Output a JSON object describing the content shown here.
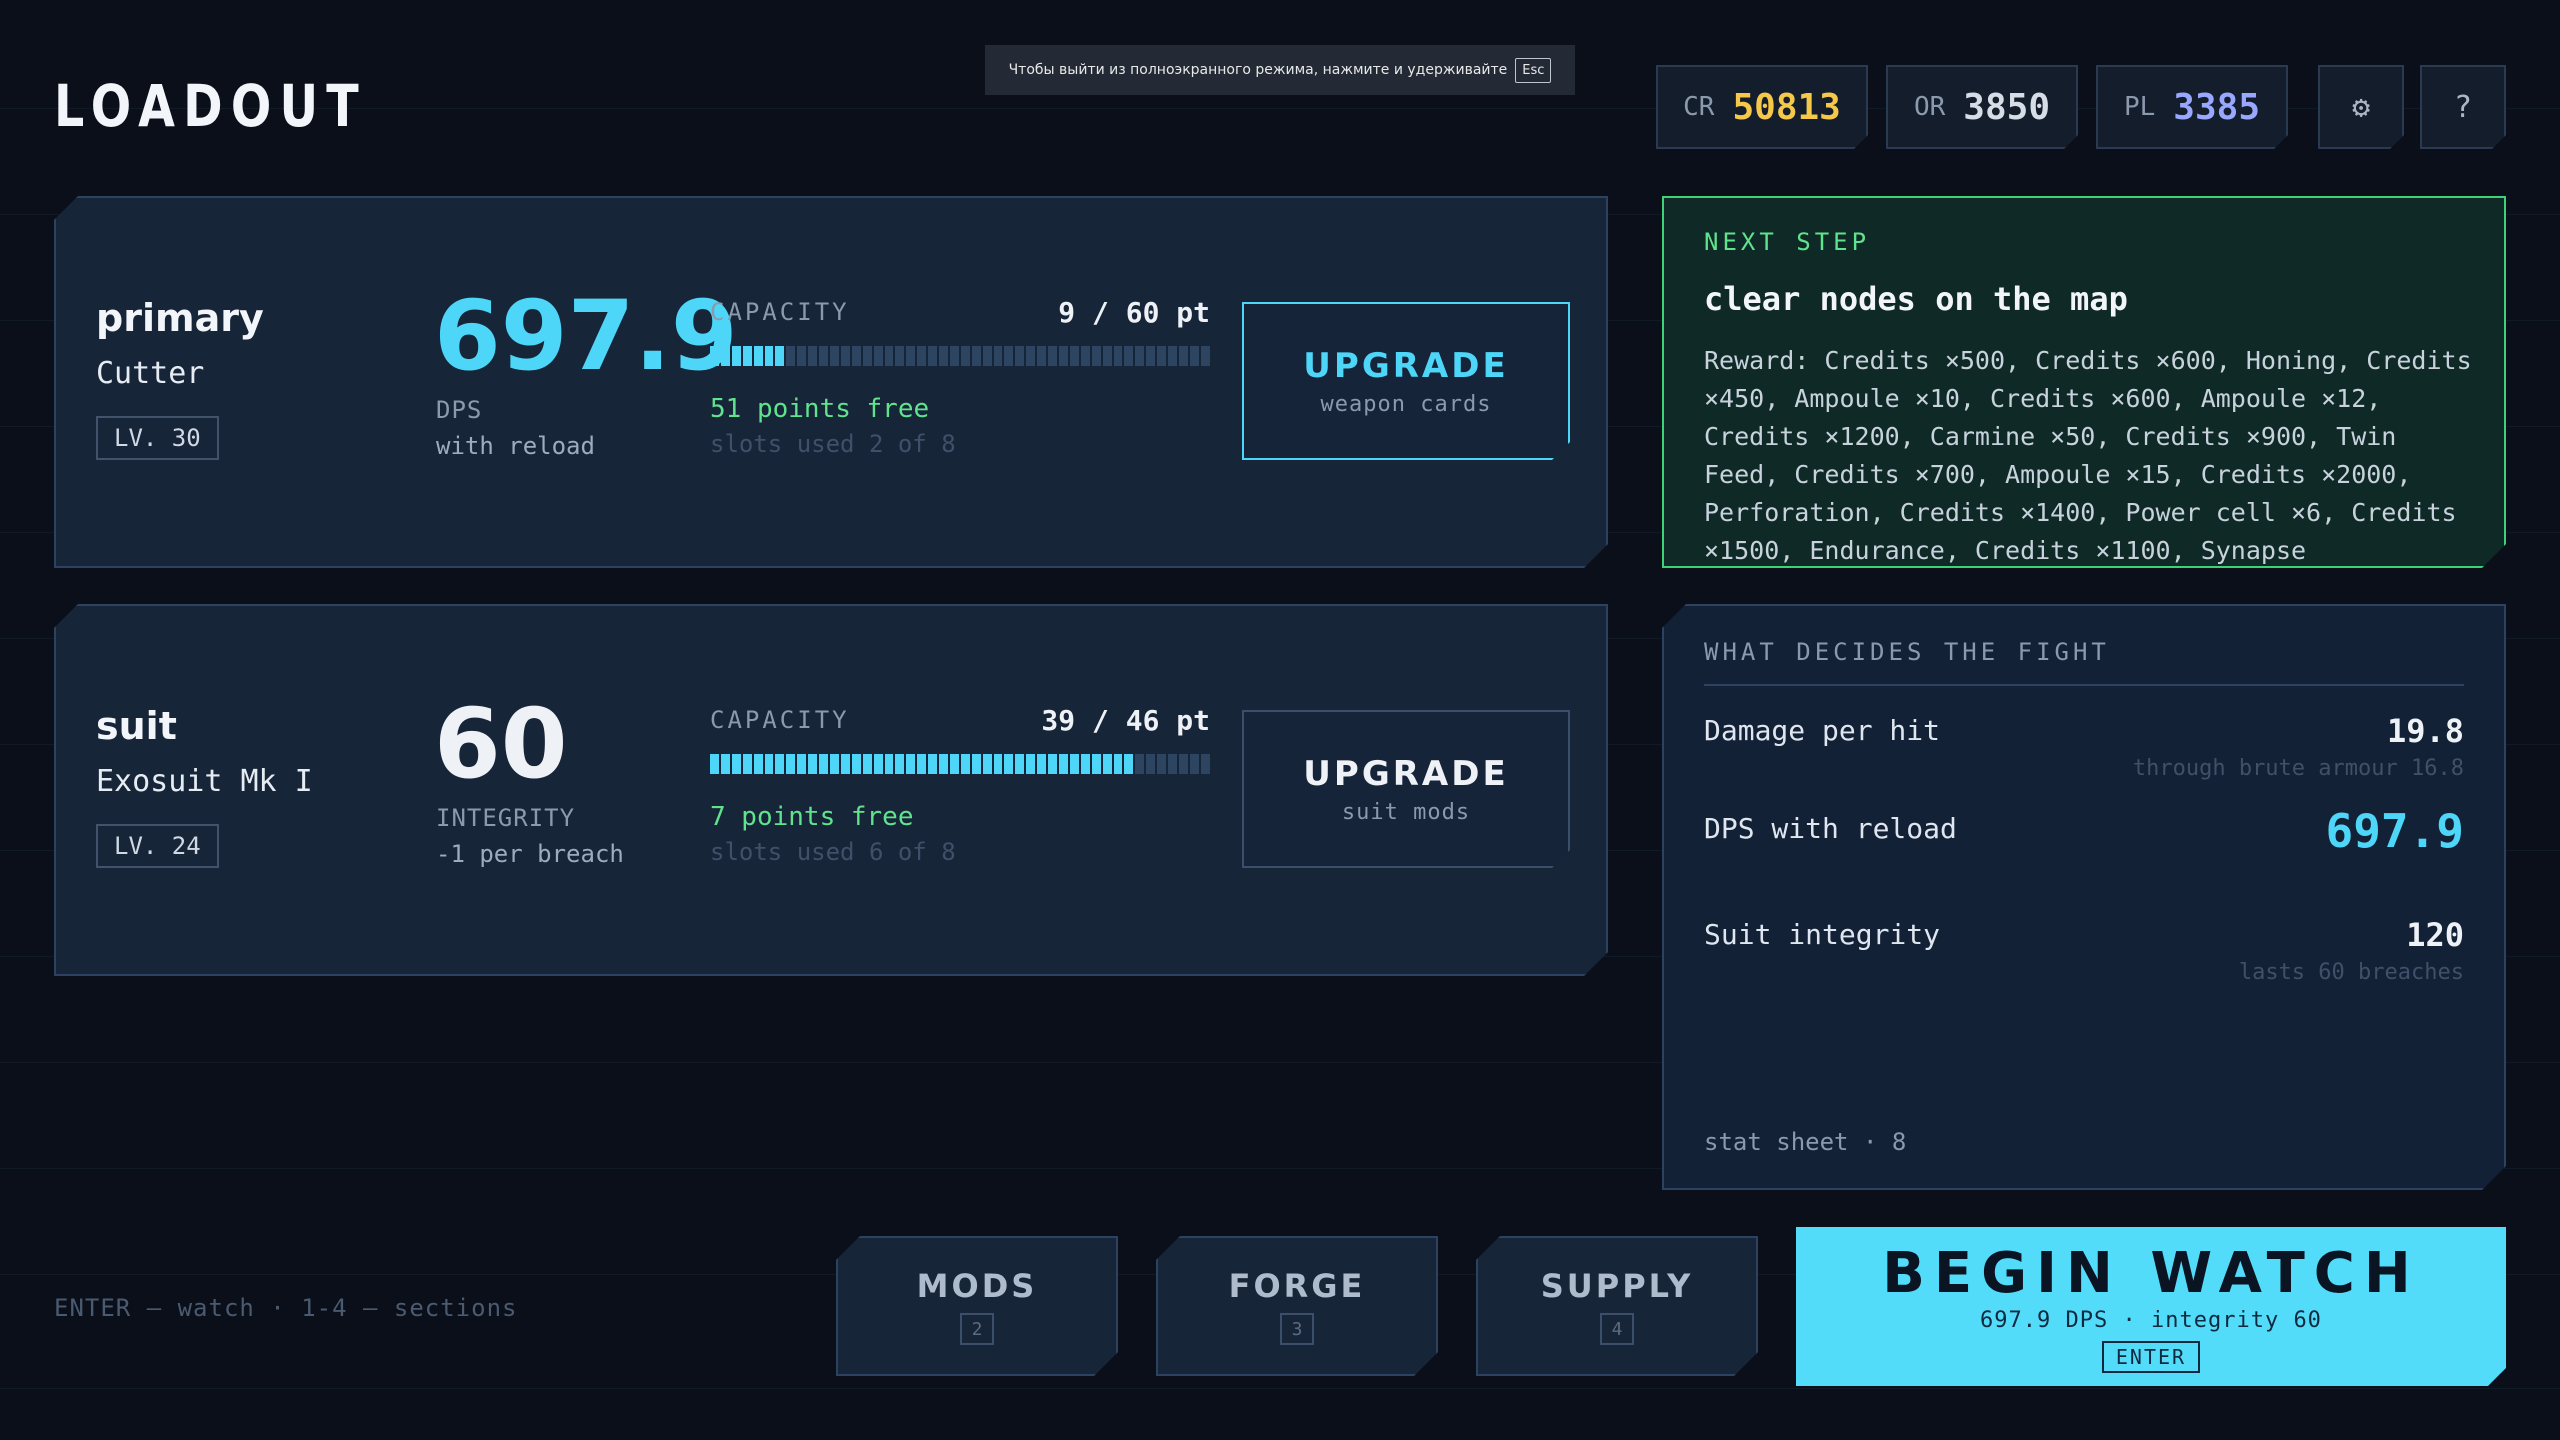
{
  "title": "LOADOUT",
  "fullscreen_banner": {
    "text": "Чтобы выйти из полноэкранного режима, нажмите и удерживайте",
    "key": "Esc"
  },
  "currencies": [
    {
      "label": "CR",
      "value": "50813",
      "color": "#f5c84a"
    },
    {
      "label": "OR",
      "value": "3850",
      "color": "#d7dde6"
    },
    {
      "label": "PL",
      "value": "3385",
      "color": "#9aa7ff"
    }
  ],
  "icons": {
    "settings": "gear-icon",
    "help": "?"
  },
  "primary": {
    "slot": "primary",
    "name": "Cutter",
    "level": "LV. 30",
    "stat": "697.9",
    "stat_label": "DPS",
    "stat_sub": "with reload",
    "capacity_label": "CAPACITY",
    "capacity_value": "9 / 60 pt",
    "capacity_used": 9,
    "capacity_max": 60,
    "free": "51 points free",
    "slots": "slots used 2 of 8",
    "upgrade_label": "UPGRADE",
    "upgrade_sub": "weapon cards",
    "accent": "#4dd6f7"
  },
  "suit": {
    "slot": "suit",
    "name": "Exosuit Mk I",
    "level": "LV. 24",
    "stat": "60",
    "stat_label": "INTEGRITY",
    "stat_sub": "-1 per breach",
    "capacity_label": "CAPACITY",
    "capacity_value": "39 / 46 pt",
    "capacity_used": 39,
    "capacity_max": 46,
    "free": "7 points free",
    "slots": "slots used 6 of 8",
    "upgrade_label": "UPGRADE",
    "upgrade_sub": "suit mods"
  },
  "next_step": {
    "heading": "NEXT STEP",
    "title": "clear nodes on the map",
    "reward": "Reward: Credits ×500, Credits ×600, Honing, Credits ×450, Ampoule ×10, Credits ×600, Ampoule ×12, Credits ×1200, Carmine ×50, Credits ×900, Twin Feed, Credits ×700, Ampoule ×15, Credits ×2000, Perforation, Credits ×1400, Power cell ×6, Credits ×1500, Endurance, Credits ×1100, Synapse"
  },
  "fight": {
    "heading": "WHAT DECIDES THE FIGHT",
    "rows": [
      {
        "label": "Damage per hit",
        "value": "19.8",
        "sub": "through brute armour 16.8"
      },
      {
        "label": "DPS with reload",
        "value": "697.9",
        "sub": ""
      },
      {
        "label": "Suit integrity",
        "value": "120",
        "sub": "lasts 60 breaches"
      }
    ],
    "footer": "stat sheet · 8"
  },
  "hint": "ENTER — watch · 1-4 — sections",
  "nav": [
    {
      "label": "MODS",
      "key": "2"
    },
    {
      "label": "FORGE",
      "key": "3"
    },
    {
      "label": "SUPPLY",
      "key": "4"
    }
  ],
  "begin": {
    "label": "BEGIN WATCH",
    "sub": "697.9 DPS · integrity 60",
    "key": "ENTER"
  }
}
